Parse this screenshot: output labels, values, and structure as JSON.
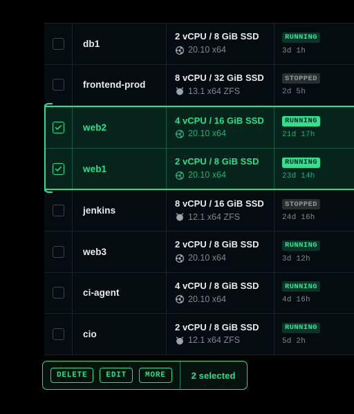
{
  "table": {
    "rows": [
      {
        "name": "db1",
        "checked": false,
        "selected": false,
        "spec": "2 vCPU / 8 GiB SSD",
        "os_icon": "ubuntu-icon",
        "os": "20.10 x64",
        "status": "RUNNING",
        "status_kind": "running",
        "uptime": "3d  1h"
      },
      {
        "name": "frontend-prod",
        "checked": false,
        "selected": false,
        "spec": "8 vCPU / 32 GiB SSD",
        "os_icon": "freebsd-icon",
        "os": "13.1 x64 ZFS",
        "status": "STOPPED",
        "status_kind": "stopped",
        "uptime": "2d  5h"
      },
      {
        "name": "web2",
        "checked": true,
        "selected": true,
        "spec": "4 vCPU / 16 GiB SSD",
        "os_icon": "ubuntu-icon",
        "os": "20.10 x64",
        "status": "RUNNING",
        "status_kind": "running",
        "uptime": "21d 17h"
      },
      {
        "name": "web1",
        "checked": true,
        "selected": true,
        "spec": "2 vCPU / 8 GiB SSD",
        "os_icon": "ubuntu-icon",
        "os": "20.10 x64",
        "status": "RUNNING",
        "status_kind": "running",
        "uptime": "23d 14h"
      },
      {
        "name": "jenkins",
        "checked": false,
        "selected": false,
        "spec": "8 vCPU / 16 GiB SSD",
        "os_icon": "freebsd-icon",
        "os": "12.1 x64 ZFS",
        "status": "STOPPED",
        "status_kind": "stopped",
        "uptime": "24d 16h"
      },
      {
        "name": "web3",
        "checked": false,
        "selected": false,
        "spec": "2 vCPU / 8 GiB SSD",
        "os_icon": "ubuntu-icon",
        "os": "20.10 x64",
        "status": "RUNNING",
        "status_kind": "running",
        "uptime": "3d 12h"
      },
      {
        "name": "ci-agent",
        "checked": false,
        "selected": false,
        "spec": "4 vCPU / 8 GiB SSD",
        "os_icon": "ubuntu-icon",
        "os": "20.10 x64",
        "status": "RUNNING",
        "status_kind": "running",
        "uptime": "4d 16h"
      },
      {
        "name": "cio",
        "checked": false,
        "selected": false,
        "spec": "2 vCPU / 8 GiB SSD",
        "os_icon": "freebsd-icon",
        "os": "12.1 x64 ZFS",
        "status": "RUNNING",
        "status_kind": "running",
        "uptime": "5d  2h"
      }
    ]
  },
  "action_bar": {
    "buttons": [
      {
        "label": "DELETE",
        "name": "delete-button"
      },
      {
        "label": "EDIT",
        "name": "edit-button"
      },
      {
        "label": "MORE",
        "name": "more-button"
      }
    ],
    "selection_count_label": "2 selected"
  },
  "colors": {
    "page_background": "#000000",
    "table_background": "#050c10",
    "accent_green": "#27e08f",
    "selected_row_background": "#06241b",
    "running_badge_background": "#0b3327",
    "stopped_badge_background": "#25302f",
    "muted_text": "#7d8b90",
    "primary_text": "#e8edf0"
  }
}
